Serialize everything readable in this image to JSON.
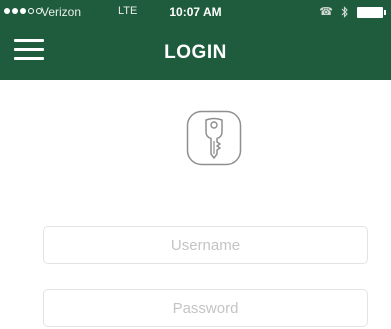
{
  "status_bar": {
    "carrier": "Verizon",
    "network": "LTE",
    "time": "10:07 AM",
    "signal_bars_filled": 3,
    "signal_bars_total": 5,
    "icons": [
      "phone-call-icon",
      "bluetooth-icon",
      "battery-icon"
    ]
  },
  "header": {
    "title": "LOGIN",
    "menu_icon": "hamburger-menu-icon"
  },
  "login": {
    "icon": "key-icon",
    "username": {
      "placeholder": "Username",
      "value": ""
    },
    "password": {
      "placeholder": "Password",
      "value": ""
    }
  },
  "colors": {
    "header_green": "#1f5b3d",
    "background": "#ffffff",
    "field_border": "#e3e3e3",
    "placeholder": "#c4c4c4"
  }
}
